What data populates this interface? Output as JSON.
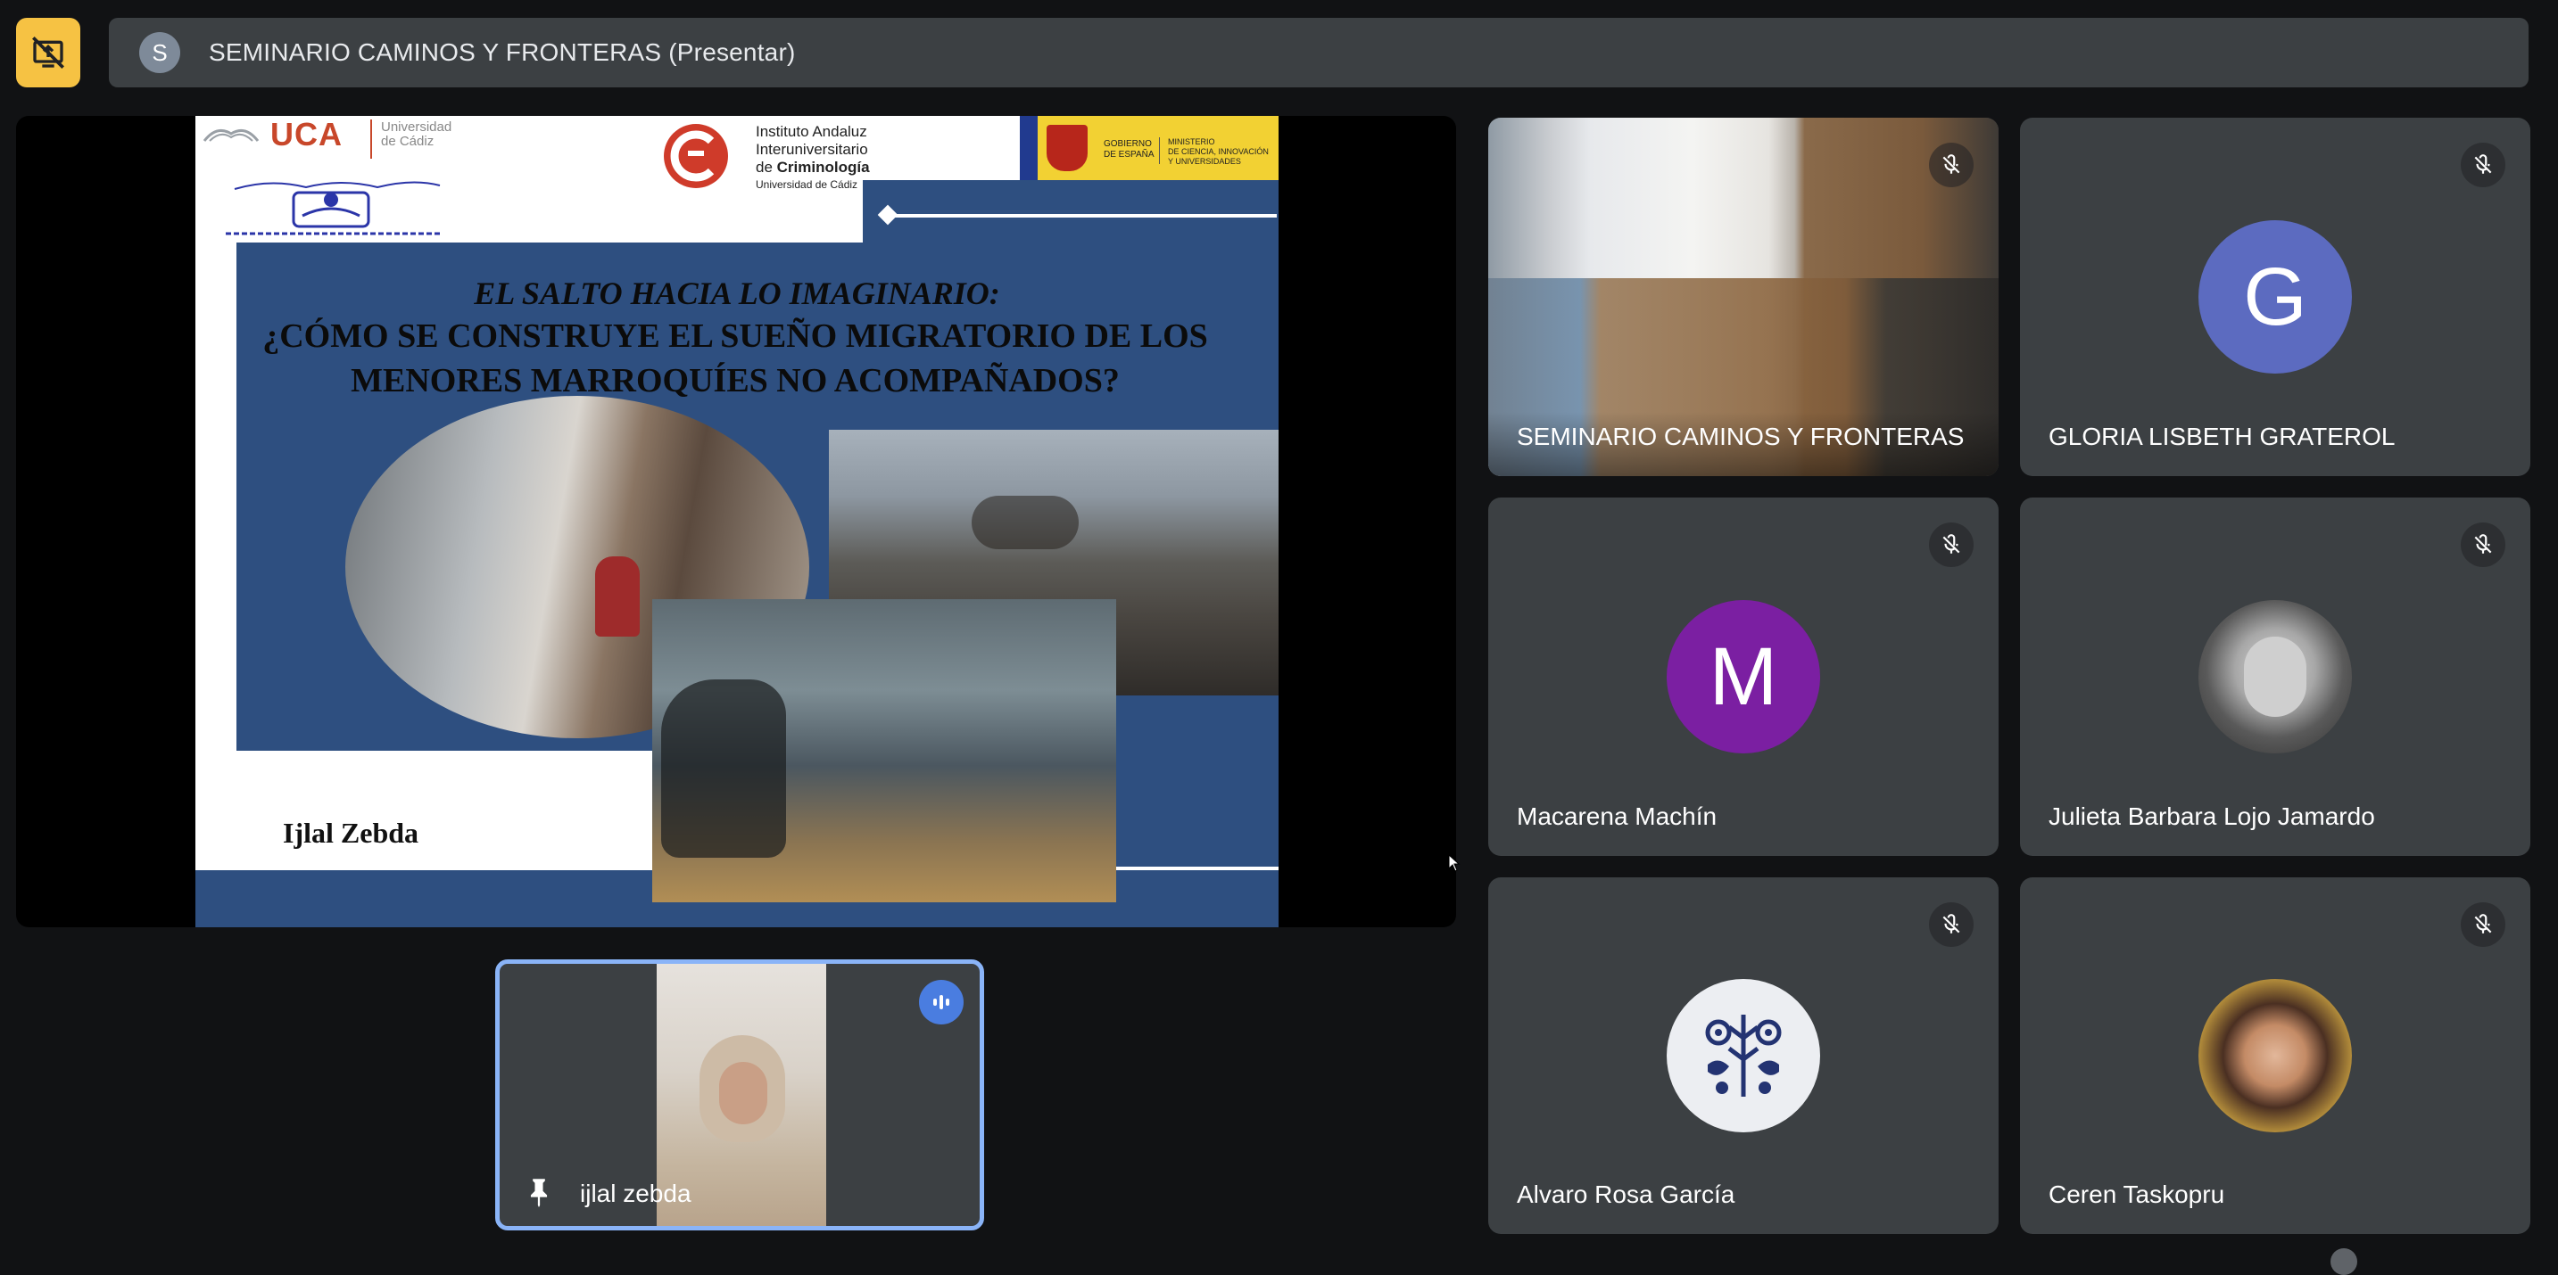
{
  "meeting": {
    "title": "SEMINARIO CAMINOS Y FRONTERAS (Presentar)",
    "avatar_letter": "S"
  },
  "slide": {
    "title_line1": "EL SALTO HACIA LO IMAGINARIO:",
    "title_line2": "¿CÓMO SE CONSTRUYE EL SUEÑO MIGRATORIO DE LOS MENORES MARROQUÍES NO ACOMPAÑADOS?",
    "author": "Ijlal Zebda",
    "uca_logo": "UCA",
    "uca_name_1": "Universidad",
    "uca_name_2": "de Cádiz",
    "iac_line1": "Instituto Andaluz",
    "iac_line2": "Interuniversitario",
    "iac_line3_prefix": "de ",
    "iac_line3_bold": "Criminología",
    "iac_line4": "Universidad de Cádiz",
    "gov_line1": "GOBIERNO",
    "gov_line2": "DE ESPAÑA",
    "ministry_line1": "MINISTERIO",
    "ministry_line2": "DE CIENCIA, INNOVACIÓN",
    "ministry_line3": "Y UNIVERSIDADES"
  },
  "speaker": {
    "name": "ijlal zebda"
  },
  "participants": [
    {
      "name": "SEMINARIO CAMINOS Y FRONTERAS",
      "type": "video"
    },
    {
      "name": "GLORIA LISBETH GRATEROL",
      "type": "letter",
      "letter": "G",
      "color": "#5c6bc0"
    },
    {
      "name": "Macarena Machín",
      "type": "letter",
      "letter": "M",
      "color": "#7b1fa2"
    },
    {
      "name": "Julieta Barbara Lojo Jamardo",
      "type": "photo"
    },
    {
      "name": "Alvaro Rosa García",
      "type": "logo"
    },
    {
      "name": "Ceren Taskopru",
      "type": "photo"
    }
  ],
  "icons": {
    "present": "present-to-all-off-icon",
    "mic_off": "mic-off-icon",
    "pin": "pin-icon",
    "speaking": "audio-level-icon"
  },
  "colors": {
    "present_button": "#f6c243",
    "speaker_border": "#8ab4f8",
    "tile_bg": "#3c4043",
    "slide_blue": "#2e4f80"
  }
}
